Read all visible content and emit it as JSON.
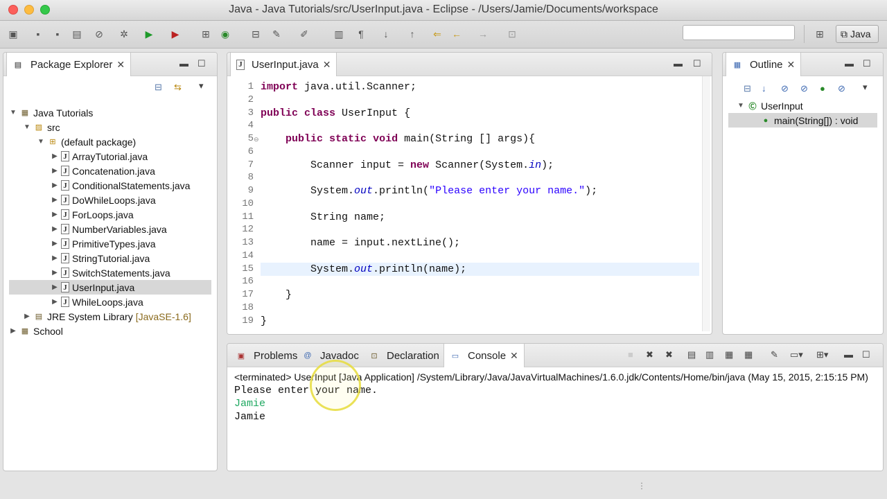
{
  "window": {
    "title": "Java - Java Tutorials/src/UserInput.java - Eclipse - /Users/Jamie/Documents/workspace"
  },
  "toolbar": {
    "perspective_label": "Java",
    "search_placeholder": ""
  },
  "package_explorer": {
    "tab_label": "Package Explorer",
    "project": "Java Tutorials",
    "src": "src",
    "package": "(default package)",
    "files": [
      "ArrayTutorial.java",
      "Concatenation.java",
      "ConditionalStatements.java",
      "DoWhileLoops.java",
      "ForLoops.java",
      "NumberVariables.java",
      "PrimitiveTypes.java",
      "StringTutorial.java",
      "SwitchStatements.java",
      "UserInput.java",
      "WhileLoops.java"
    ],
    "jre_label": "JRE System Library",
    "jre_version": "[JavaSE-1.6]",
    "project2": "School"
  },
  "editor": {
    "tab_label": "UserInput.java",
    "line_numbers": [
      "1",
      "2",
      "3",
      "4",
      "5",
      "6",
      "7",
      "8",
      "9",
      "10",
      "11",
      "12",
      "13",
      "14",
      "15",
      "16",
      "17",
      "18",
      "19"
    ]
  },
  "outline": {
    "tab_label": "Outline",
    "class_name": "UserInput",
    "method": "main(String[]) : void"
  },
  "bottom_tabs": {
    "problems": "Problems",
    "javadoc": "Javadoc",
    "declaration": "Declaration",
    "console": "Console"
  },
  "console": {
    "header": "<terminated> UserInput [Java Application] /System/Library/Java/JavaVirtualMachines/1.6.0.jdk/Contents/Home/bin/java (May 15, 2015, 2:15:15 PM)",
    "line1": "Please enter your name.",
    "line2": "Jamie",
    "line3": "Jamie"
  },
  "colors": {
    "keyword": "#7f0055",
    "string": "#2a00ff",
    "static_field": "#0000c0",
    "console_input": "#1ea860"
  }
}
